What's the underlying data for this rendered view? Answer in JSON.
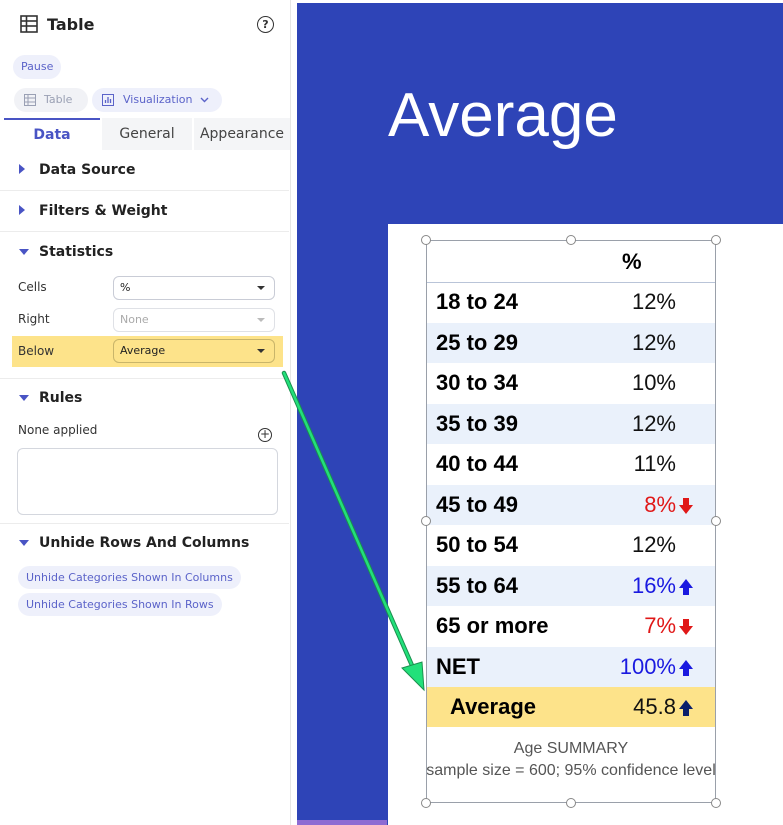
{
  "panel": {
    "title": "Table",
    "help": "?",
    "pause": "Pause",
    "object_table": "Table",
    "object_viz": "Visualization",
    "tabs": [
      "Data",
      "General",
      "Appearance"
    ],
    "sections": {
      "data_source": "Data Source",
      "filters": "Filters & Weight",
      "statistics": "Statistics",
      "rules": "Rules",
      "unhide": "Unhide Rows And Columns"
    },
    "stats": {
      "cells_label": "Cells",
      "cells_value": "%",
      "right_label": "Right",
      "right_value": "None",
      "below_label": "Below",
      "below_value": "Average"
    },
    "rules_none": "None applied",
    "unhide_cols": "Unhide Categories Shown In Columns",
    "unhide_rows": "Unhide Categories Shown In Rows"
  },
  "slide": {
    "title": "Average",
    "column_header": "%",
    "rows": [
      {
        "category": "18 to 24",
        "value": "12%",
        "indicator": "none"
      },
      {
        "category": "25 to 29",
        "value": "12%",
        "indicator": "none"
      },
      {
        "category": "30 to 34",
        "value": "10%",
        "indicator": "none"
      },
      {
        "category": "35 to 39",
        "value": "12%",
        "indicator": "none"
      },
      {
        "category": "40 to 44",
        "value": "11%",
        "indicator": "none"
      },
      {
        "category": "45 to 49",
        "value": "8%",
        "indicator": "down"
      },
      {
        "category": "50 to 54",
        "value": "12%",
        "indicator": "none"
      },
      {
        "category": "55 to 64",
        "value": "16%",
        "indicator": "up"
      },
      {
        "category": "65 or more",
        "value": "7%",
        "indicator": "down"
      },
      {
        "category": "NET",
        "value": "100%",
        "indicator": "up"
      },
      {
        "category": "Average",
        "value": "45.8",
        "indicator": "up-dark"
      }
    ],
    "footer_line1": "Age SUMMARY",
    "footer_line2": "sample size = 600; 95% confidence level"
  },
  "colors": {
    "accent": "#4954c4",
    "slide_bg": "#2e44b7",
    "highlight": "#fde38a",
    "up": "#1a1ae0",
    "down": "#e01818",
    "arrow": "#22e07a"
  }
}
